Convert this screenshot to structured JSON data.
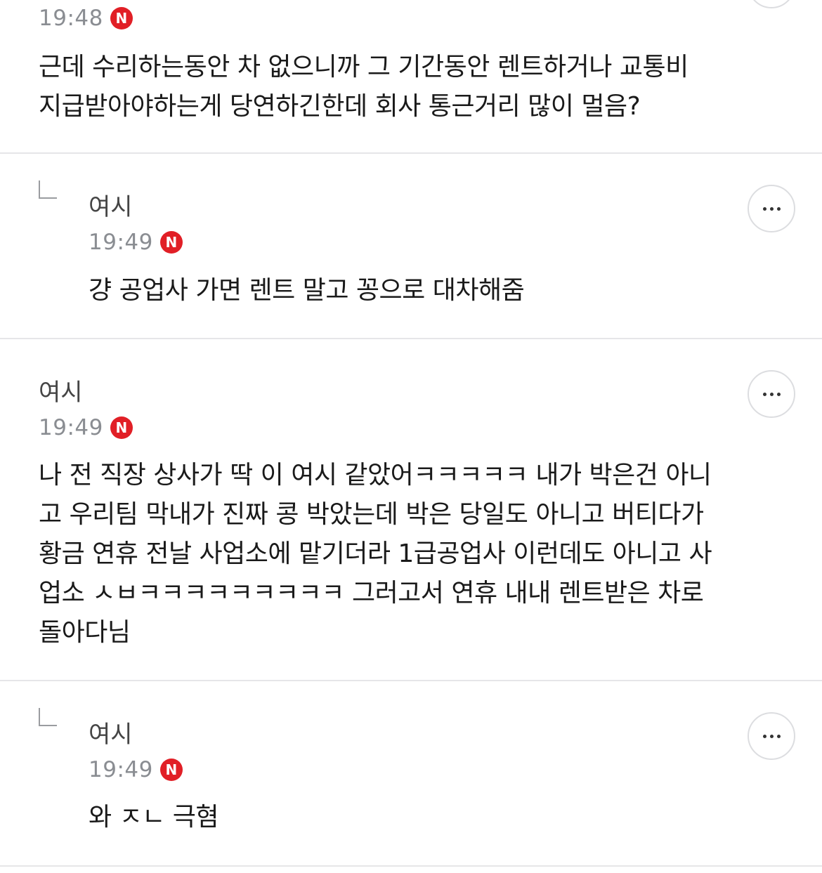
{
  "comments": [
    {
      "author": "",
      "time": "19:48",
      "badge": "N",
      "lines": [
        "근데 수리하는동안 차 없으니까 그 기간동안 렌트하거나 교통비",
        "지급받아야하는게 당연하긴한데 회사 통근거리 많이 멀음?"
      ]
    },
    {
      "author": "여시",
      "time": "19:49",
      "badge": "N",
      "lines": [
        "걍 공업사 가면 렌트 말고 꽁으로 대차해줌"
      ]
    },
    {
      "author": "여시",
      "time": "19:49",
      "badge": "N",
      "lines": [
        "나 전 직장 상사가 딱 이 여시 같았어ㅋㅋㅋㅋㅋ 내가 박은건 아니",
        "고 우리팀 막내가 진짜 콩 박았는데 박은 당일도 아니고 버티다가",
        "황금 연휴 전날 사업소에 맡기더라 1급공업사 이런데도 아니고 사",
        "업소 ㅅㅂㅋㅋㅋㅋㅋㅋㅋㅋㅋ 그러고서 연휴 내내 렌트받은 차로",
        "돌아다님"
      ]
    },
    {
      "author": "여시",
      "time": "19:49",
      "badge": "N",
      "lines": [
        "와 ㅈㄴ 극혐"
      ]
    }
  ]
}
